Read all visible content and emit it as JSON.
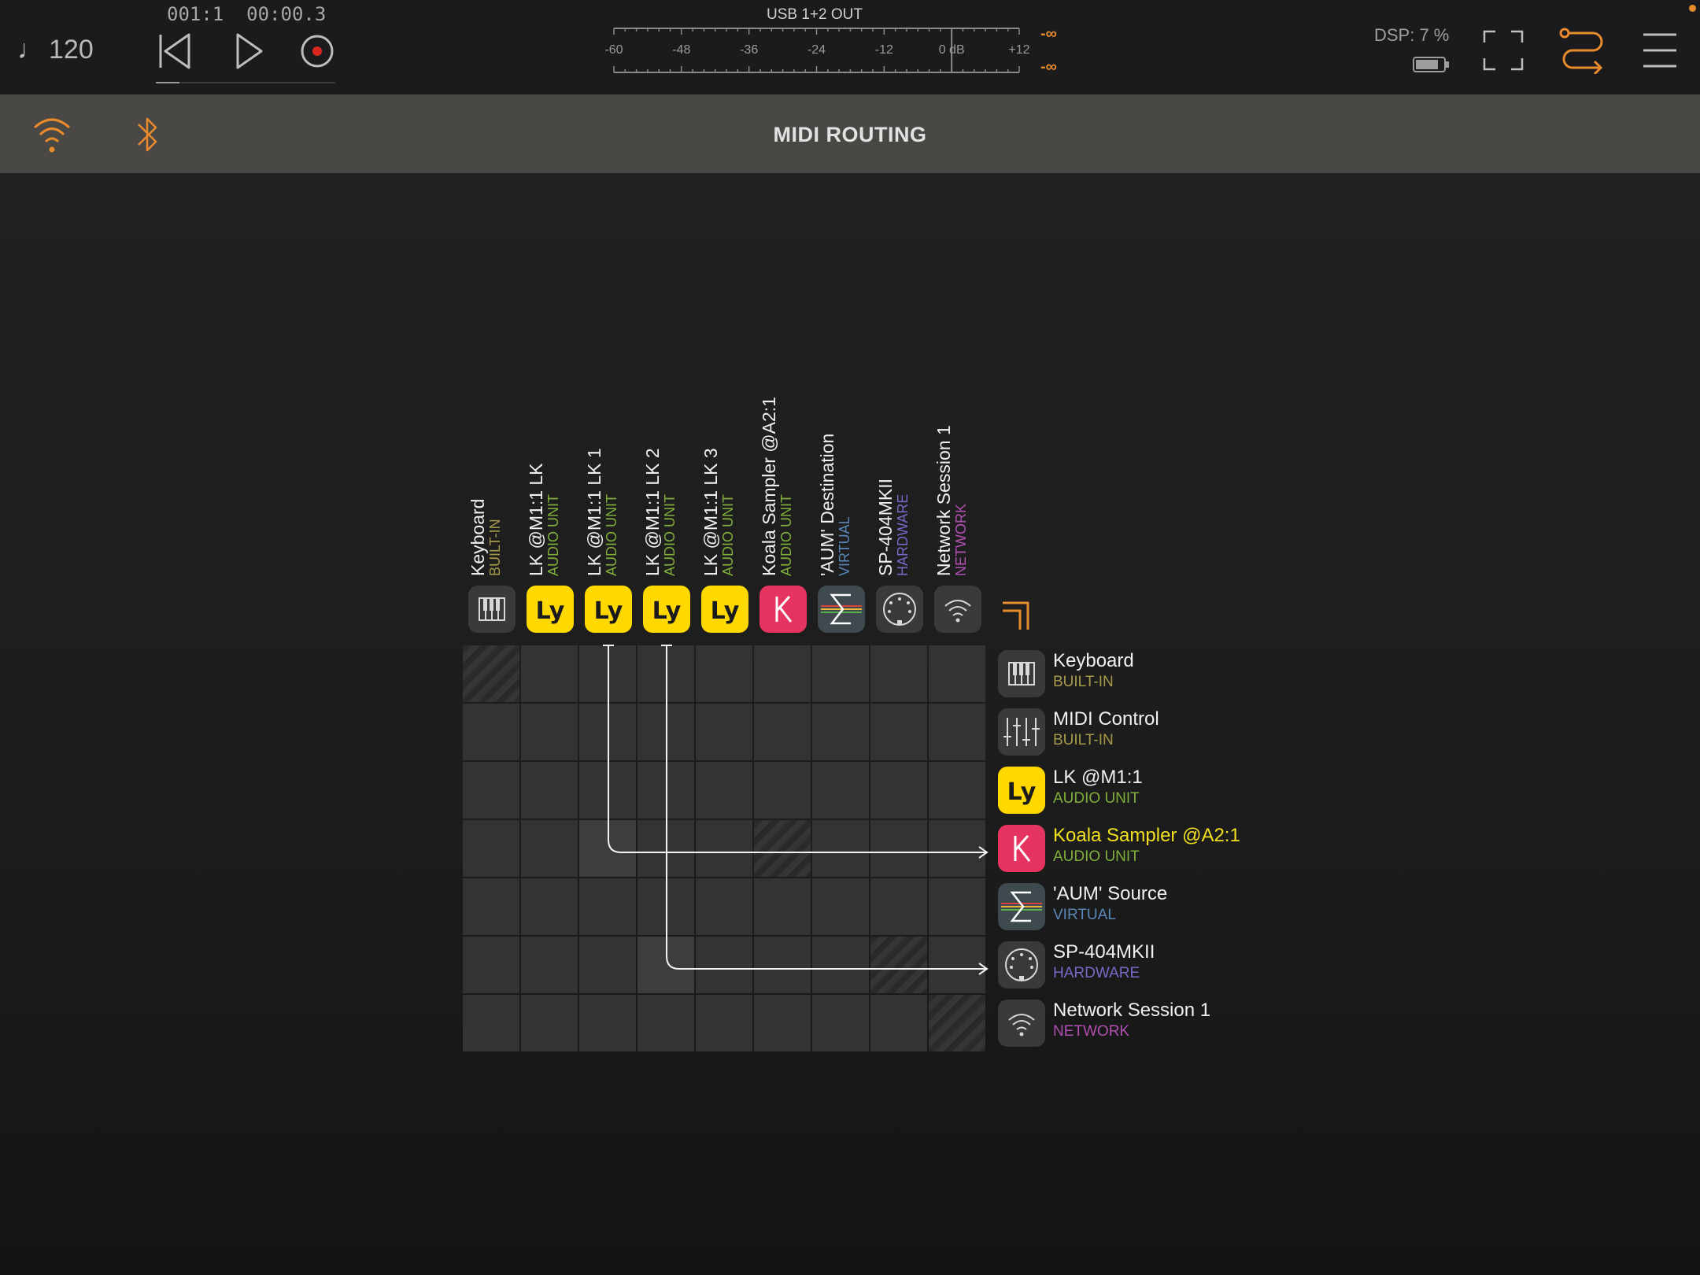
{
  "topbar": {
    "tempo": "120",
    "tempo_icon": "quarter-note-icon",
    "timecode": "001:1  00:00.3",
    "progress": 0.13,
    "meter_title": "USB 1+2 OUT",
    "meter_labels": [
      "-60",
      "-48",
      "-36",
      "-24",
      "-12",
      "0 dB",
      "+12"
    ],
    "peak_top": "-∞",
    "peak_bottom": "-∞",
    "dsp": "DSP:  7 %"
  },
  "header": {
    "title": "MIDI ROUTING"
  },
  "columns": [
    {
      "name": "Keyboard",
      "type": "BUILT-IN",
      "kind": "builtin",
      "icon": "piano-keys-icon"
    },
    {
      "name": "LK @M1:1 LK",
      "type": "AUDIO UNIT",
      "kind": "au",
      "icon": "lk-app-icon"
    },
    {
      "name": "LK @M1:1 LK 1",
      "type": "AUDIO UNIT",
      "kind": "au",
      "icon": "lk-app-icon"
    },
    {
      "name": "LK @M1:1 LK 2",
      "type": "AUDIO UNIT",
      "kind": "au",
      "icon": "lk-app-icon"
    },
    {
      "name": "LK @M1:1 LK 3",
      "type": "AUDIO UNIT",
      "kind": "au",
      "icon": "lk-app-icon"
    },
    {
      "name": "Koala Sampler @A2:1",
      "type": "AUDIO UNIT",
      "kind": "au",
      "icon": "koala-app-icon"
    },
    {
      "name": "'AUM' Destination",
      "type": "VIRTUAL",
      "kind": "virtual",
      "icon": "aum-sigma-icon"
    },
    {
      "name": "SP-404MKII",
      "type": "HARDWARE",
      "kind": "hw",
      "icon": "midi-din-icon"
    },
    {
      "name": "Network Session 1",
      "type": "NETWORK",
      "kind": "net",
      "icon": "network-wifi-icon"
    }
  ],
  "rows": [
    {
      "name": "Keyboard",
      "type": "BUILT-IN",
      "kind": "builtin",
      "icon": "piano-keys-icon"
    },
    {
      "name": "MIDI Control",
      "type": "BUILT-IN",
      "kind": "builtin",
      "icon": "faders-icon"
    },
    {
      "name": "LK @M1:1",
      "type": "AUDIO UNIT",
      "kind": "au",
      "icon": "lk-app-icon"
    },
    {
      "name": "Koala Sampler @A2:1",
      "type": "AUDIO UNIT",
      "kind": "au",
      "icon": "koala-app-icon",
      "highlight": "#f2e01e"
    },
    {
      "name": "'AUM' Source",
      "type": "VIRTUAL",
      "kind": "virtual",
      "icon": "aum-sigma-icon"
    },
    {
      "name": "SP-404MKII",
      "type": "HARDWARE",
      "kind": "hw",
      "icon": "midi-din-icon"
    },
    {
      "name": "Network Session 1",
      "type": "NETWORK",
      "kind": "net",
      "icon": "network-wifi-icon"
    }
  ],
  "connections": [
    {
      "column": 2,
      "row": 3
    },
    {
      "column": 3,
      "row": 5
    }
  ],
  "colors": {
    "accent": "#e98a2c",
    "lk_yellow": "#ffd800",
    "koala_red": "#e5345f",
    "highlight": "#f2e01e"
  }
}
